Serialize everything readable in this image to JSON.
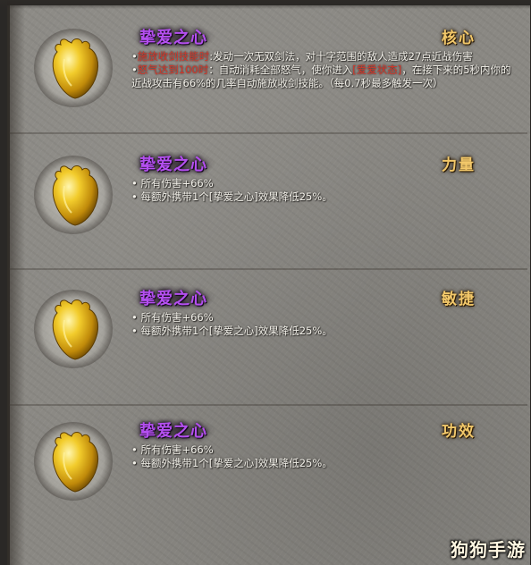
{
  "items": [
    {
      "name": "挚爱之心",
      "type": "核心",
      "lines": [
        {
          "prefix": "•",
          "highlight": "施放收剑技能时",
          "text": "发动一次无双剑法，对十字范围的敌人造成27点近战伤害"
        },
        {
          "prefix": "•",
          "highlight": "怒气达到100时",
          "text": "：自动消耗全部怒气，使你进入",
          "highlight2": "[爱爱状态]",
          "text2": "，在接下来的5秒内你的近战攻击有66%的几率自动施放收剑技能。（每0.7秒最多触发一次）"
        }
      ]
    },
    {
      "name": "挚爱之心",
      "type": "力量",
      "lines": [
        {
          "prefix": "•",
          "text": "所有伤害+66%"
        },
        {
          "prefix": "•",
          "text": "每额外携带1个[挚爱之心]效果降低25%。"
        }
      ]
    },
    {
      "name": "挚爱之心",
      "type": "敏捷",
      "lines": [
        {
          "prefix": "•",
          "text": "所有伤害+66%"
        },
        {
          "prefix": "•",
          "text": "每额外携带1个[挚爱之心]效果降低25%。"
        }
      ]
    },
    {
      "name": "挚爱之心",
      "type": "功效",
      "lines": [
        {
          "prefix": "•",
          "text": "所有伤害+66%"
        },
        {
          "prefix": "•",
          "text": "每额外携带1个[挚爱之心]效果降低25%。"
        }
      ]
    }
  ],
  "watermark": "狗狗手游",
  "colors": {
    "name": "#b44ff0",
    "type": "#f2c86a",
    "highlight": "#d4372a",
    "text": "#f3f1ea",
    "heart": "#e0b21c"
  },
  "icons": [
    "golden-heart-icon"
  ]
}
